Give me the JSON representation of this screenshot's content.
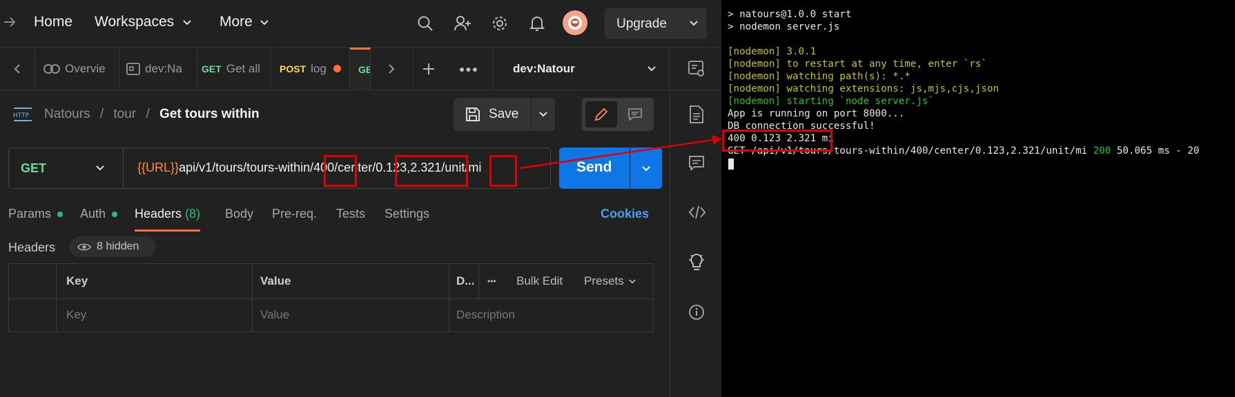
{
  "topbar": {
    "home": "Home",
    "workspaces": "Workspaces",
    "more": "More",
    "upgrade": "Upgrade"
  },
  "tabs": [
    {
      "method": "",
      "label": "Overvie"
    },
    {
      "method": "",
      "label": "dev:Na"
    },
    {
      "method": "GET",
      "label": "Get all"
    },
    {
      "method": "POST",
      "label": "log"
    },
    {
      "method": "GE",
      "label": ""
    }
  ],
  "environment": "dev:Natour",
  "breadcrumb": {
    "icon_text": "HTTP",
    "collection": "Natours",
    "sep": "/",
    "folder": "tour",
    "request": "Get tours within"
  },
  "save_label": "Save",
  "request": {
    "method": "GET",
    "url_var": "{{URL}}",
    "url_path": "api/v1/tours/tours-within/400/center/0.123,2.321/unit/mi",
    "send_label": "Send"
  },
  "subtabs": {
    "params": "Params",
    "auth": "Auth",
    "headers": "Headers",
    "headers_count": "(8)",
    "body": "Body",
    "prereq": "Pre-req.",
    "tests": "Tests",
    "settings": "Settings",
    "cookies": "Cookies"
  },
  "headers_section": {
    "title": "Headers",
    "hidden": "8 hidden",
    "col_key": "Key",
    "col_value": "Value",
    "col_desc": "D...",
    "dots": "•••",
    "bulk_edit": "Bulk Edit",
    "presets": "Presets",
    "ph_key": "Key",
    "ph_value": "Value",
    "ph_desc": "Description"
  },
  "terminal": {
    "lines": [
      "> natours@1.0.0 start",
      "> nodemon server.js",
      "",
      "[nodemon] 3.0.1",
      "[nodemon] to restart at any time, enter `rs`",
      "[nodemon] watching path(s): *.*",
      "[nodemon] watching extensions: js,mjs,cjs,json",
      "[nodemon] starting `node server.js`",
      "App is running on port 8000...",
      "DB connection successful!",
      "400 0.123 2.321 mi"
    ],
    "log_prefix": "GET /api/v1/tours/tours-within/400/center/0.123,2.321/unit/mi ",
    "log_status": "200",
    "log_suffix": " 50.065 ms - 20"
  },
  "colors": {
    "accent_orange": "#ff6c37",
    "send_blue": "#0f76e6",
    "get_green": "#6bdd9a",
    "post_yellow": "#ffd84d",
    "annotation_red": "#e00000",
    "nodemon_yellow": "#c8c800",
    "nodemon_green": "#1ec81e"
  }
}
